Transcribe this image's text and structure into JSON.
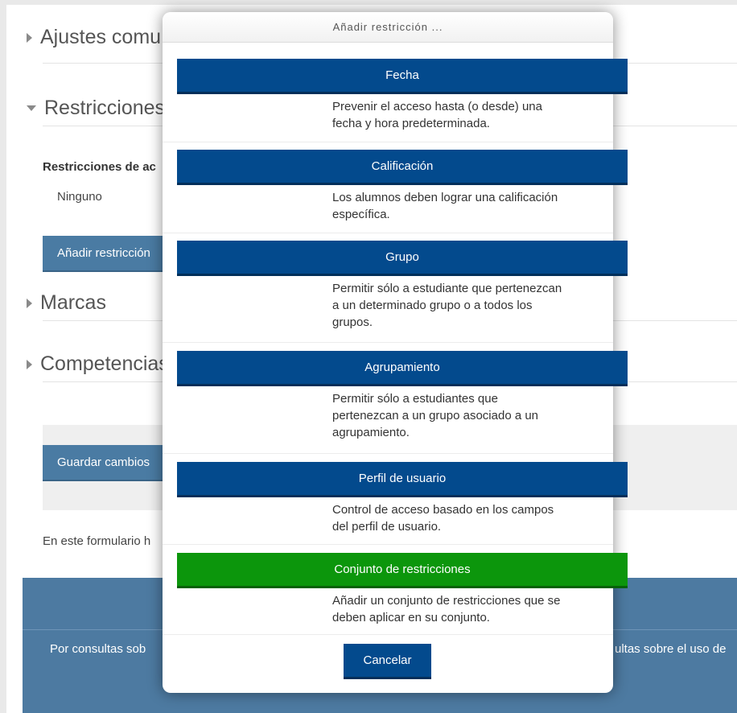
{
  "background": {
    "sections": [
      {
        "label": "Ajustes comu",
        "expanded": false
      },
      {
        "label": "Restricciones",
        "expanded": true
      },
      {
        "label": "Marcas",
        "expanded": false
      },
      {
        "label": "Competencias",
        "expanded": false
      }
    ],
    "restrictions_label": "Restricciones de ac",
    "restrictions_value": "Ninguno",
    "add_restriction_button": "Añadir restricción",
    "save_button": "Guardar cambios",
    "form_note": "En este formulario h",
    "footer_left": "Por consultas sob",
    "footer_right": "ultas sobre el uso de"
  },
  "modal": {
    "title": "Añadir restricción ...",
    "options": [
      {
        "label": "Fecha",
        "description": [
          "Prevenir el acceso hasta (o desde) una",
          "fecha y hora predeterminada."
        ],
        "color": "#034a8d"
      },
      {
        "label": "Calificación",
        "description": [
          "Los alumnos deben lograr una calificación",
          "específica."
        ],
        "color": "#034a8d"
      },
      {
        "label": "Grupo",
        "description": [
          "Permitir sólo a estudiante que pertenezcan",
          "a un determinado grupo o a todos los",
          "grupos."
        ],
        "color": "#034a8d"
      },
      {
        "label": "Agrupamiento",
        "description": [
          "Permitir sólo a estudiantes que",
          "pertenezcan a un grupo asociado a un",
          "agrupamiento."
        ],
        "color": "#034a8d"
      },
      {
        "label": "Perfil de usuario",
        "description": [
          "Control de acceso basado en los campos",
          "del perfil de usuario."
        ],
        "color": "#034a8d"
      },
      {
        "label": "Conjunto de restricciones",
        "description": [
          "Añadir un conjunto de restricciones que se",
          "deben aplicar en su conjunto."
        ],
        "color": "#0c960c"
      }
    ],
    "cancel_button": "Cancelar"
  }
}
